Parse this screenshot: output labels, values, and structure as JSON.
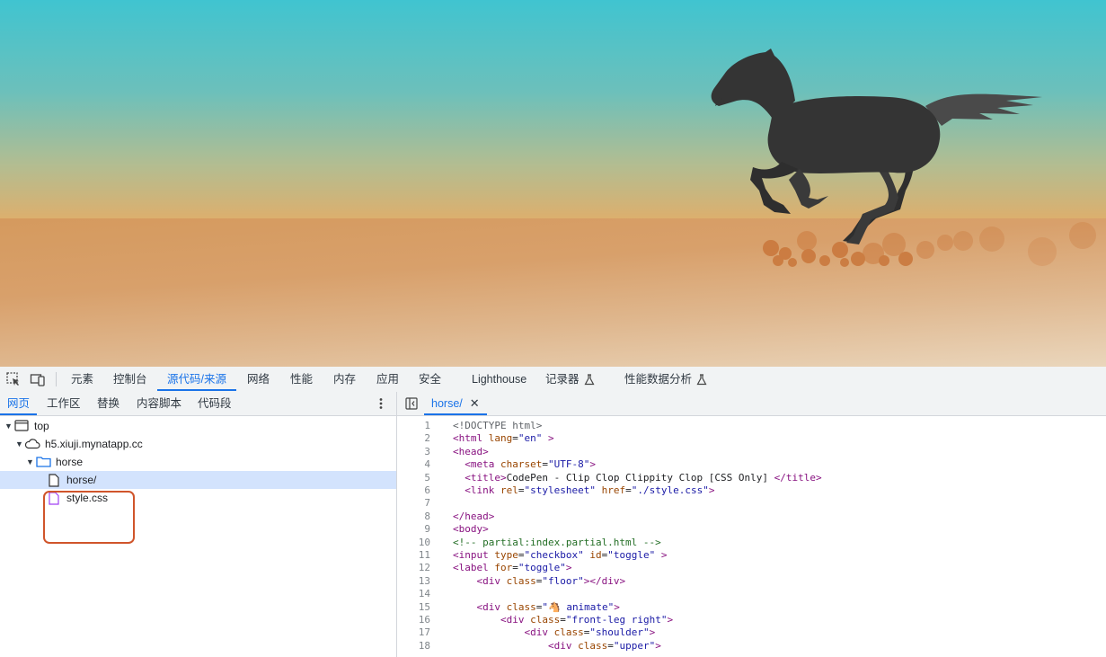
{
  "toolbar": {
    "tabs": [
      {
        "label": "元素"
      },
      {
        "label": "控制台"
      },
      {
        "label": "源代码/来源"
      },
      {
        "label": "网络"
      },
      {
        "label": "性能"
      },
      {
        "label": "内存"
      },
      {
        "label": "应用"
      },
      {
        "label": "安全"
      },
      {
        "label": "Lighthouse"
      },
      {
        "label": "记录器"
      },
      {
        "label": "性能数据分析"
      }
    ],
    "active_tab": "源代码/来源"
  },
  "navigator": {
    "tabs": [
      {
        "label": "网页"
      },
      {
        "label": "工作区"
      },
      {
        "label": "替换"
      },
      {
        "label": "内容脚本"
      },
      {
        "label": "代码段"
      }
    ],
    "active_tab": "网页",
    "tree": [
      {
        "label": "top",
        "icon": "frame-icon"
      },
      {
        "label": "h5.xiuji.mynatapp.cc",
        "icon": "cloud-icon"
      },
      {
        "label": "horse",
        "icon": "folder-icon"
      },
      {
        "label": "horse/",
        "icon": "document-icon",
        "selected": true
      },
      {
        "label": "style.css",
        "icon": "css-file-icon"
      }
    ]
  },
  "editor": {
    "open_file": "horse/",
    "lines": [
      {
        "n": "1",
        "text": "<!DOCTYPE html>"
      },
      {
        "n": "2",
        "text": "<html lang=\"en\" >"
      },
      {
        "n": "3",
        "text": "<head>"
      },
      {
        "n": "4",
        "text": "  <meta charset=\"UTF-8\">"
      },
      {
        "n": "5",
        "text": "  <title>CodePen - Clip Clop Clippity Clop [CSS Only] </title>"
      },
      {
        "n": "6",
        "text": "  <link rel=\"stylesheet\" href=\"./style.css\">"
      },
      {
        "n": "7",
        "text": ""
      },
      {
        "n": "8",
        "text": "</head>"
      },
      {
        "n": "9",
        "text": "<body>"
      },
      {
        "n": "10",
        "text": "<!-- partial:index.partial.html -->"
      },
      {
        "n": "11",
        "text": "<input type=\"checkbox\" id=\"toggle\" >"
      },
      {
        "n": "12",
        "text": "<label for=\"toggle\">"
      },
      {
        "n": "13",
        "text": "    <div class=\"floor\"></div>"
      },
      {
        "n": "14",
        "text": ""
      },
      {
        "n": "15",
        "text": "    <div class=\"🐴 animate\">"
      },
      {
        "n": "16",
        "text": "        <div class=\"front-leg right\">"
      },
      {
        "n": "17",
        "text": "            <div class=\"shoulder\">"
      },
      {
        "n": "18",
        "text": "                <div class=\"upper\">"
      }
    ]
  },
  "colors": {
    "accent": "#1a73e8",
    "highlight_box": "#d0552b",
    "horse": "#343434"
  }
}
